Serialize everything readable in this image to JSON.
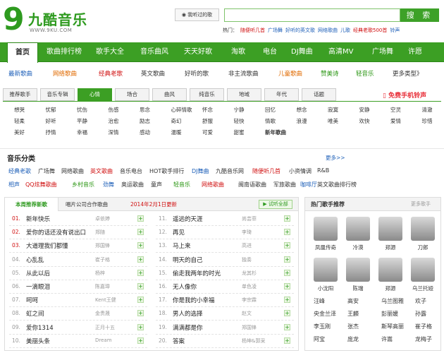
{
  "brand": {
    "logo_mark": "9",
    "name": "九酷音乐",
    "url": "WWW.9KU.COM"
  },
  "header": {
    "heard_btn": "我听过的歌",
    "search_placeholder": "",
    "search_btn": "搜 索",
    "hot_label": "热门：",
    "hot_items": [
      {
        "t": "随便听几首",
        "c": "red"
      },
      {
        "t": "广场舞",
        "c": "blue"
      },
      {
        "t": "好听的英文歌",
        "c": "blue"
      },
      {
        "t": "网络歌曲",
        "c": "blue"
      },
      {
        "t": "儿歌",
        "c": "blue"
      },
      {
        "t": "经典老歌500首",
        "c": "red"
      },
      {
        "t": "铃声",
        "c": "blue"
      }
    ]
  },
  "nav": [
    "首页",
    "歌曲排行榜",
    "歌手大全",
    "音乐曲风",
    "天天好歌",
    "淘歌",
    "电台",
    "DJ舞曲",
    "高清MV",
    "广场舞",
    "许愿"
  ],
  "categories": [
    {
      "t": "最新歌曲",
      "c": "blue"
    },
    {
      "t": "网络歌曲",
      "c": "orange"
    },
    {
      "t": "经典老歌",
      "c": "red"
    },
    {
      "t": "英文歌曲",
      "c": ""
    },
    {
      "t": "好听的歌",
      "c": ""
    },
    {
      "t": "非主流歌曲",
      "c": ""
    },
    {
      "t": "儿童歌曲",
      "c": "orange"
    },
    {
      "t": "赞美诗",
      "c": "green"
    },
    {
      "t": "轻音乐",
      "c": "green"
    },
    {
      "t": "更多类型》",
      "c": ""
    }
  ],
  "tabs": [
    "推荐歌手",
    "音乐专辑",
    "心情",
    "场合",
    "曲风",
    "纯音乐",
    "地域",
    "年代",
    "话题"
  ],
  "ringtone": "免费手机铃声",
  "moods": [
    [
      "想哭",
      "忧郁",
      "忧伤",
      "伤感",
      "思念",
      "心碎情歌",
      "怀念",
      "宁静",
      "回忆",
      "想念",
      "寂寞",
      "安静",
      "空灵",
      "清澈"
    ],
    [
      "轻柔",
      "好听",
      "平静",
      "治愈",
      "励志",
      "奇幻",
      "舒服",
      "轻快",
      "情歌",
      "浪漫",
      "唯美",
      "欢快",
      "爱情",
      "珍惜"
    ],
    [
      "美好",
      "抒情",
      "幸福",
      "深情",
      "感动",
      "温暖",
      "可爱",
      "甜蜜",
      "新年歌曲"
    ]
  ],
  "music_cats": {
    "title": "音乐分类",
    "more": "更多>>",
    "row1": [
      {
        "t": "经典老歌",
        "c": "blue"
      },
      {
        "t": "广场舞",
        "c": ""
      },
      {
        "t": "网络歌曲",
        "c": ""
      },
      {
        "t": "英文歌曲",
        "c": "red"
      },
      {
        "t": "音乐电台",
        "c": ""
      },
      {
        "t": "HOT歌手排行",
        "c": ""
      },
      {
        "t": "DJ舞曲",
        "c": "blue"
      },
      {
        "t": "九酷音乐网",
        "c": ""
      },
      {
        "t": "随便听几首",
        "c": "red"
      },
      {
        "t": "小资情调",
        "c": ""
      },
      {
        "t": "R&B",
        "c": ""
      }
    ],
    "row2": [
      {
        "t": "相声",
        "c": "blue"
      },
      {
        "t": "QQ炫舞歌曲",
        "c": "red"
      },
      {
        "t": "乡村音乐",
        "c": "green"
      },
      {
        "t": "劲舞",
        "c": "blue"
      },
      {
        "t": "奥运歌曲",
        "c": ""
      },
      {
        "t": "童声",
        "c": ""
      },
      {
        "t": "轻音乐",
        "c": "green"
      },
      {
        "t": "网络歌曲",
        "c": "red"
      },
      {
        "t": "闽南语歌曲",
        "c": ""
      },
      {
        "t": "军旅歌曲",
        "c": ""
      },
      {
        "t": "咖啡厅",
        "c": "blue"
      },
      {
        "t": "英文歌曲排行榜",
        "c": ""
      }
    ]
  },
  "songs_panel": {
    "tab_active": "本周推荐新歌",
    "tab_2": "唱片公司合作歌曲",
    "update": "2014年2月1日更新",
    "play_all": "试听全部",
    "left": [
      {
        "n": "01.",
        "song": "新年快乐",
        "artist": "卓依婷"
      },
      {
        "n": "02.",
        "song": "爱你的话还没有说出口",
        "artist": "郑随"
      },
      {
        "n": "03.",
        "song": "大道理我们都懂",
        "artist": "郑国锋"
      },
      {
        "n": "04.",
        "song": "心乱乱",
        "artist": "崔子格"
      },
      {
        "n": "05.",
        "song": "从此以后",
        "artist": "杨梓"
      },
      {
        "n": "06.",
        "song": "一滴眼泪",
        "artist": "陈嘉瑋"
      },
      {
        "n": "07.",
        "song": "呵呵",
        "artist": "Kent王健"
      },
      {
        "n": "08.",
        "song": "虹之间",
        "artist": "金贵晟"
      },
      {
        "n": "09.",
        "song": "爱你1314",
        "artist": "正月十五"
      },
      {
        "n": "10.",
        "song": "美丽头条",
        "artist": "Dream"
      }
    ],
    "right": [
      {
        "n": "11.",
        "song": "遥远的天涯",
        "artist": "尚芸菲"
      },
      {
        "n": "12.",
        "song": "再见",
        "artist": "李琦"
      },
      {
        "n": "13.",
        "song": "马上来",
        "artist": "高进"
      },
      {
        "n": "14.",
        "song": "明天的自己",
        "artist": "独奏"
      },
      {
        "n": "15.",
        "song": "偷走我两年的时光",
        "artist": "龙其杉"
      },
      {
        "n": "16.",
        "song": "无人像你",
        "artist": "单色凌"
      },
      {
        "n": "17.",
        "song": "你是我的小幸福",
        "artist": "李宗霖"
      },
      {
        "n": "18.",
        "song": "男人的选择",
        "artist": "赵文"
      },
      {
        "n": "19.",
        "song": "满满都是你",
        "artist": "郑国锋"
      },
      {
        "n": "20.",
        "song": "答案",
        "artist": "杨坤&郭采"
      }
    ]
  },
  "singers_panel": {
    "title": "热门歌手推荐",
    "more": "更多歌手",
    "photos": [
      "凤凰传奇",
      "冷漠",
      "郑源",
      "刀郎",
      "小沈阳",
      "陈瑞",
      "郑源",
      "乌兰托娅"
    ],
    "names": [
      [
        "汪峰",
        "高安",
        "乌兰图雅",
        "欢子"
      ],
      [
        "央金兰泽",
        "王麟",
        "彭丽媛",
        "孙露"
      ],
      [
        "李玉刚",
        "张杰",
        "斯琴高丽",
        "崔子格"
      ],
      [
        "阿宝",
        "庞龙",
        "许嵩",
        "龙梅子"
      ]
    ]
  }
}
